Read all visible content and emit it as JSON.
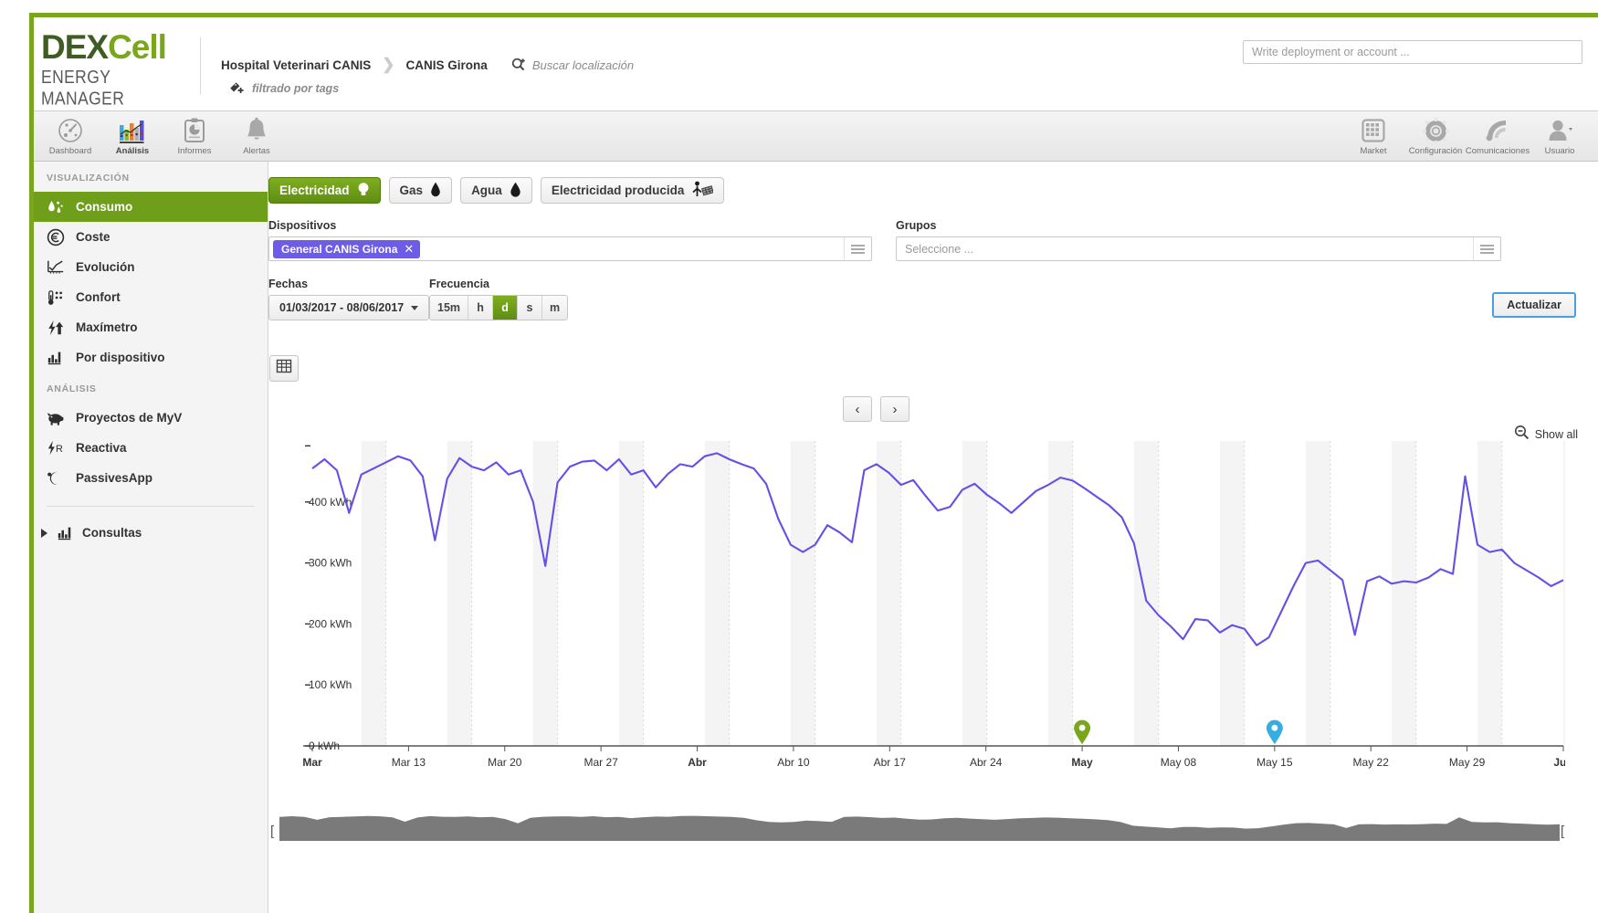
{
  "brand": {
    "logo_main_dark": "DEX",
    "logo_main_accent": "Cell",
    "logo_sub": "ENERGY MANAGER",
    "accent_color": "#7aa61e",
    "dark_green": "#3f5c22"
  },
  "header": {
    "breadcrumb": [
      {
        "label": "Hospital Veterinari CANIS"
      },
      {
        "label": "CANIS Girona"
      }
    ],
    "breadcrumb_separator": "❯",
    "search_location_label": "Buscar localización",
    "tag_filter_label": "filtrado por tags",
    "account_search_placeholder": "Write deployment or account ..."
  },
  "iconnav": {
    "left": [
      {
        "label": "Dashboard",
        "icon": "gauge-icon",
        "active": false
      },
      {
        "label": "Análisis",
        "icon": "bar-chart-icon",
        "active": true
      },
      {
        "label": "Informes",
        "icon": "clipboard-report-icon",
        "active": false
      },
      {
        "label": "Alertas",
        "icon": "bell-icon",
        "active": false
      }
    ],
    "right": [
      {
        "label": "Market",
        "icon": "grid-icon",
        "active": false
      },
      {
        "label": "Configuración",
        "icon": "gear-icon",
        "active": false
      },
      {
        "label": "Comunicaciones",
        "icon": "satellite-icon",
        "active": false
      },
      {
        "label": "Usuario",
        "icon": "user-icon",
        "active": false
      }
    ]
  },
  "sidebar": {
    "section_visualizacion": "VISUALIZACIÓN",
    "section_analisis": "ANÁLISIS",
    "visualizacion_items": [
      {
        "label": "Consumo",
        "icon": "consumption-icon",
        "active": true
      },
      {
        "label": "Coste",
        "icon": "euro-icon",
        "active": false
      },
      {
        "label": "Evolución",
        "icon": "trend-icon",
        "active": false
      },
      {
        "label": "Confort",
        "icon": "thermometer-icon",
        "active": false
      },
      {
        "label": "Maxímetro",
        "icon": "peak-demand-icon",
        "active": false
      },
      {
        "label": "Por dispositivo",
        "icon": "device-bars-icon",
        "active": false
      }
    ],
    "analisis_items": [
      {
        "label": "Proyectos de MyV",
        "icon": "piggy-bank-icon",
        "active": false
      },
      {
        "label": "Reactiva",
        "icon": "reactive-power-icon",
        "active": false
      },
      {
        "label": "PassivesApp",
        "icon": "moon-icon",
        "active": false
      }
    ],
    "consultas": {
      "label": "Consultas",
      "icon": "bar-chart-small-icon",
      "expanded": false
    }
  },
  "main": {
    "tabs": [
      {
        "label": "Electricidad",
        "icon": "lightbulb-icon",
        "active": true
      },
      {
        "label": "Gas",
        "icon": "flame-icon",
        "active": false
      },
      {
        "label": "Agua",
        "icon": "water-drop-icon",
        "active": false
      },
      {
        "label": "Electricidad producida",
        "icon": "solar-panel-icon",
        "active": false
      }
    ],
    "devices": {
      "label": "Dispositivos",
      "chips": [
        {
          "label": "General CANIS Girona",
          "remove": "✕",
          "color": "#6c5ce7"
        }
      ]
    },
    "groups": {
      "label": "Grupos",
      "placeholder": "Seleccione ..."
    },
    "dates": {
      "label": "Fechas",
      "value": "01/03/2017 - 08/06/2017"
    },
    "frequency": {
      "label": "Frecuencia",
      "options": [
        {
          "label": "15m",
          "active": false
        },
        {
          "label": "h",
          "active": false
        },
        {
          "label": "d",
          "active": true
        },
        {
          "label": "s",
          "active": false
        },
        {
          "label": "m",
          "active": false
        }
      ]
    },
    "update_button": "Actualizar",
    "table_toggle": "grid-view-icon",
    "prev_button": "‹",
    "next_button": "›",
    "show_all": {
      "label": "Show all",
      "icon": "zoom-out-icon"
    }
  },
  "chart_data": {
    "type": "line",
    "title": "",
    "xlabel": "",
    "ylabel": "kWh",
    "ylim": [
      0,
      500
    ],
    "ytick_labels": [
      "0 kWh",
      "100 kWh",
      "200 kWh",
      "300 kWh",
      "400 kWh"
    ],
    "ytick_values": [
      0,
      100,
      200,
      300,
      400
    ],
    "grid": false,
    "legend": "none",
    "line_color": "#6450e8",
    "xtick_labels": [
      "Mar",
      "Mar 13",
      "Mar 20",
      "Mar 27",
      "Abr",
      "Abr 10",
      "Abr 17",
      "Abr 24",
      "May",
      "May 08",
      "May 15",
      "May 22",
      "May 29",
      "Jun"
    ],
    "xtick_bold": [
      "Mar",
      "Abr",
      "May",
      "Jun"
    ],
    "x_start": "2017-03-01",
    "x_end": "2017-06-08",
    "series": [
      {
        "name": "General CANIS Girona",
        "unit": "kWh",
        "values": [
          455,
          470,
          452,
          382,
          445,
          455,
          465,
          475,
          468,
          442,
          337,
          438,
          472,
          458,
          452,
          465,
          445,
          452,
          400,
          295,
          432,
          458,
          466,
          468,
          452,
          470,
          445,
          452,
          424,
          446,
          462,
          458,
          475,
          480,
          470,
          462,
          455,
          430,
          372,
          330,
          318,
          330,
          362,
          350,
          334,
          452,
          462,
          448,
          428,
          436,
          410,
          386,
          392,
          420,
          430,
          412,
          398,
          382,
          400,
          418,
          428,
          440,
          435,
          422,
          408,
          394,
          375,
          332,
          238,
          214,
          196,
          175,
          208,
          206,
          186,
          198,
          192,
          165,
          178,
          220,
          262,
          300,
          304,
          288,
          272,
          182,
          270,
          278,
          266,
          270,
          268,
          276,
          290,
          282,
          442,
          330,
          318,
          322,
          300,
          288,
          276,
          262,
          272
        ]
      }
    ],
    "weekend_bands": 14,
    "markers": [
      {
        "type": "map-pin",
        "color": "#7aa61e",
        "x_label": "May"
      },
      {
        "type": "map-pin",
        "color": "#35aee2",
        "x_label": "May 15"
      }
    ]
  }
}
